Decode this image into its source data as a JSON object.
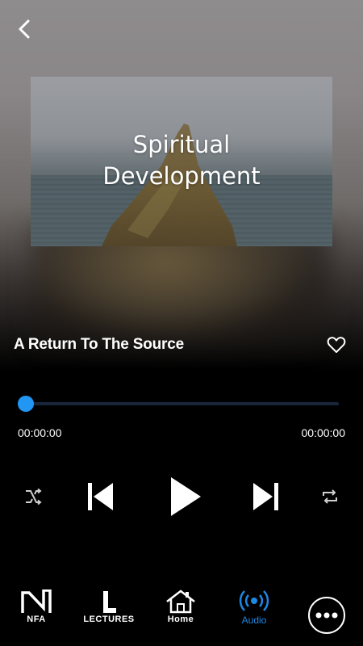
{
  "screen": {
    "artwork_title": "Spiritual\nDevelopment",
    "track_title": "A Return To The Source"
  },
  "player": {
    "progress_fraction": 0,
    "current_time": "00:00:00",
    "duration": "00:00:00"
  },
  "controls": {
    "back_icon": "chevron-left-icon",
    "favorite_icon": "heart-outline-icon",
    "shuffle_icon": "shuffle-icon",
    "previous_icon": "skip-previous-icon",
    "play_icon": "play-icon",
    "next_icon": "skip-next-icon",
    "repeat_icon": "repeat-icon"
  },
  "nav": {
    "items": [
      {
        "label": "NFA",
        "icon": "nfa-logo-icon"
      },
      {
        "label": "LECTURES",
        "icon": "lectures-l-icon"
      },
      {
        "label": "Home",
        "icon": "home-icon"
      },
      {
        "label": "Audio",
        "icon": "broadcast-icon",
        "active": true
      },
      {
        "label": "",
        "icon": "more-icon"
      }
    ]
  },
  "colors": {
    "accent": "#1e88e5",
    "background": "#000000",
    "progress_track": "#19263a"
  }
}
